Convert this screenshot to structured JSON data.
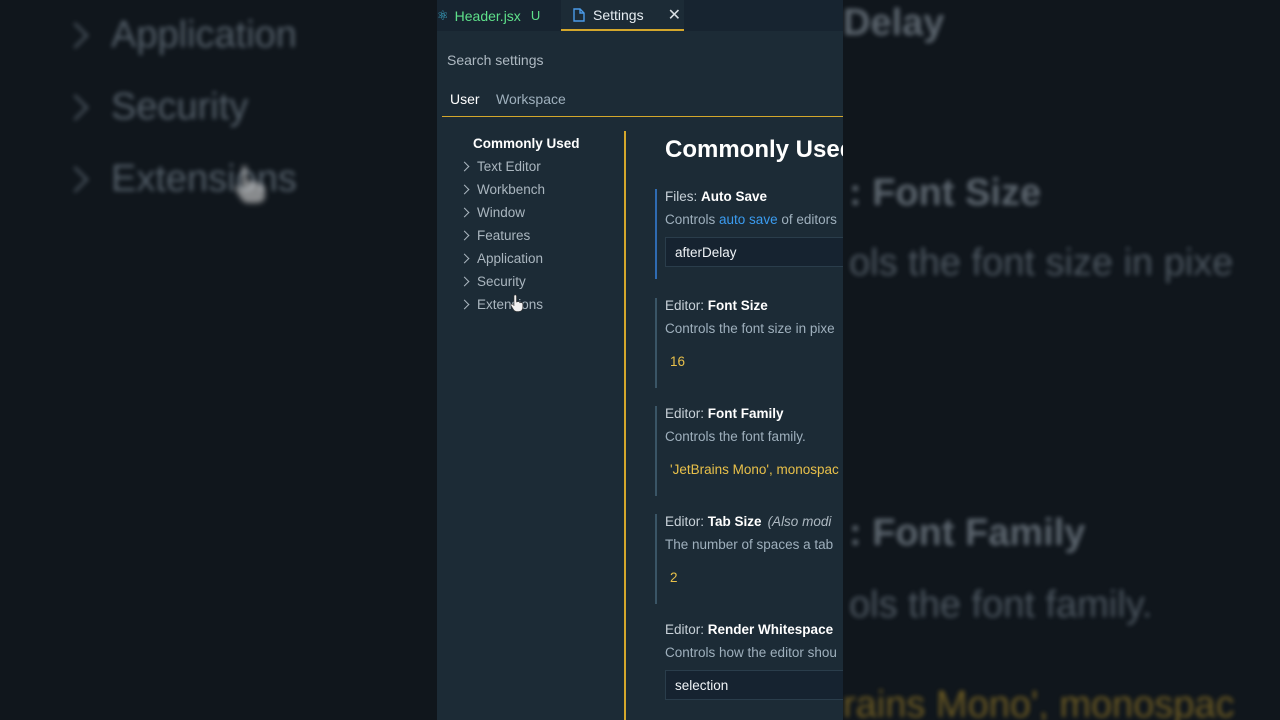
{
  "background": {
    "left_items": [
      "Application",
      "Security",
      "Extensions"
    ],
    "right_texts": {
      "delay": "Delay",
      "font_size_title": ": Font Size",
      "font_size_desc": "ols the font size in pixe",
      "font_family_title": ": Font Family",
      "font_family_desc": "ols the font family.",
      "font_family_value": "rains Mono', monospac"
    }
  },
  "tabs": {
    "header": {
      "label": "Header.jsx",
      "status": "U"
    },
    "settings": {
      "label": "Settings",
      "close": "✕"
    }
  },
  "search": {
    "placeholder": "Search settings",
    "value": ""
  },
  "scope_tabs": {
    "user": "User",
    "workspace": "Workspace"
  },
  "tree": {
    "active": "Commonly Used",
    "items": [
      "Text Editor",
      "Workbench",
      "Window",
      "Features",
      "Application",
      "Security",
      "Extensions"
    ]
  },
  "content": {
    "heading": "Commonly Used",
    "settings": [
      {
        "category": "Files:",
        "name": "Auto Save",
        "desc_pre": "Controls ",
        "desc_link": "auto save",
        "desc_post": " of editors",
        "value": "afterDelay"
      },
      {
        "category": "Editor:",
        "name": "Font Size",
        "desc": "Controls the font size in pixe",
        "value": "16"
      },
      {
        "category": "Editor:",
        "name": "Font Family",
        "desc": "Controls the font family.",
        "value": "'JetBrains Mono', monospac"
      },
      {
        "category": "Editor:",
        "name": "Tab Size",
        "note": "(Also modi",
        "desc": "The number of spaces a tab",
        "value": "2"
      },
      {
        "category": "Editor:",
        "name": "Render Whitespace",
        "desc": "Controls how the editor shou",
        "value": "selection"
      }
    ]
  },
  "colors": {
    "panel_bg": "#1c2b36",
    "accent_gold": "#d4a72c",
    "link_blue": "#3b9cf0",
    "value_yellow": "#e8c04a",
    "modified_green": "#5ee08a"
  }
}
